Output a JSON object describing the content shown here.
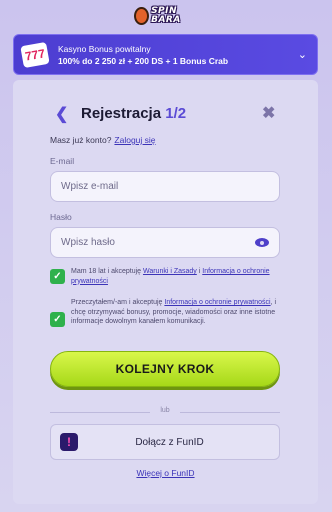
{
  "brand": {
    "logo_text": "SPIN BARA"
  },
  "bonus": {
    "line1": "Kasyno Bonus powitalny",
    "line2": "100% do 2 250 zł + 200 DS + 1 Bonus Crab",
    "icon": "777-slot-icon",
    "badge": "777"
  },
  "registration": {
    "title": "Rejestracja",
    "step": "1/2",
    "have_account": "Masz już konto?",
    "login_link": "Zaloguj się",
    "email": {
      "label": "E-mail",
      "placeholder": "Wpisz e-mail",
      "value": ""
    },
    "password": {
      "label": "Hasło",
      "placeholder": "Wpisz hasło",
      "value": ""
    },
    "consent_age": {
      "checked": true,
      "text_before": "Mam 18 lat i akceptuję ",
      "terms_link": "Warunki i Zasady",
      "text_mid": " i ",
      "privacy_link": "Informacja o ochronie prywatności"
    },
    "consent_marketing": {
      "checked": true,
      "text_before": "Przeczytałem/-am i akceptuję ",
      "privacy_link": "Informacja o ochronie prywatności",
      "text_after": ", i chcę otrzymywać bonusy, promocje, wiadomości oraz inne istotne informacje dowolnym kanałem komunikacji."
    },
    "next_button": "KOLEJNY KROK",
    "or": "lub",
    "funid_button": "Dołącz z FunID",
    "more_link": "Więcej o FunID"
  },
  "colors": {
    "accent": "#5b4bd5",
    "cta_green": "#b9e42a",
    "check_green": "#2fb14c"
  }
}
